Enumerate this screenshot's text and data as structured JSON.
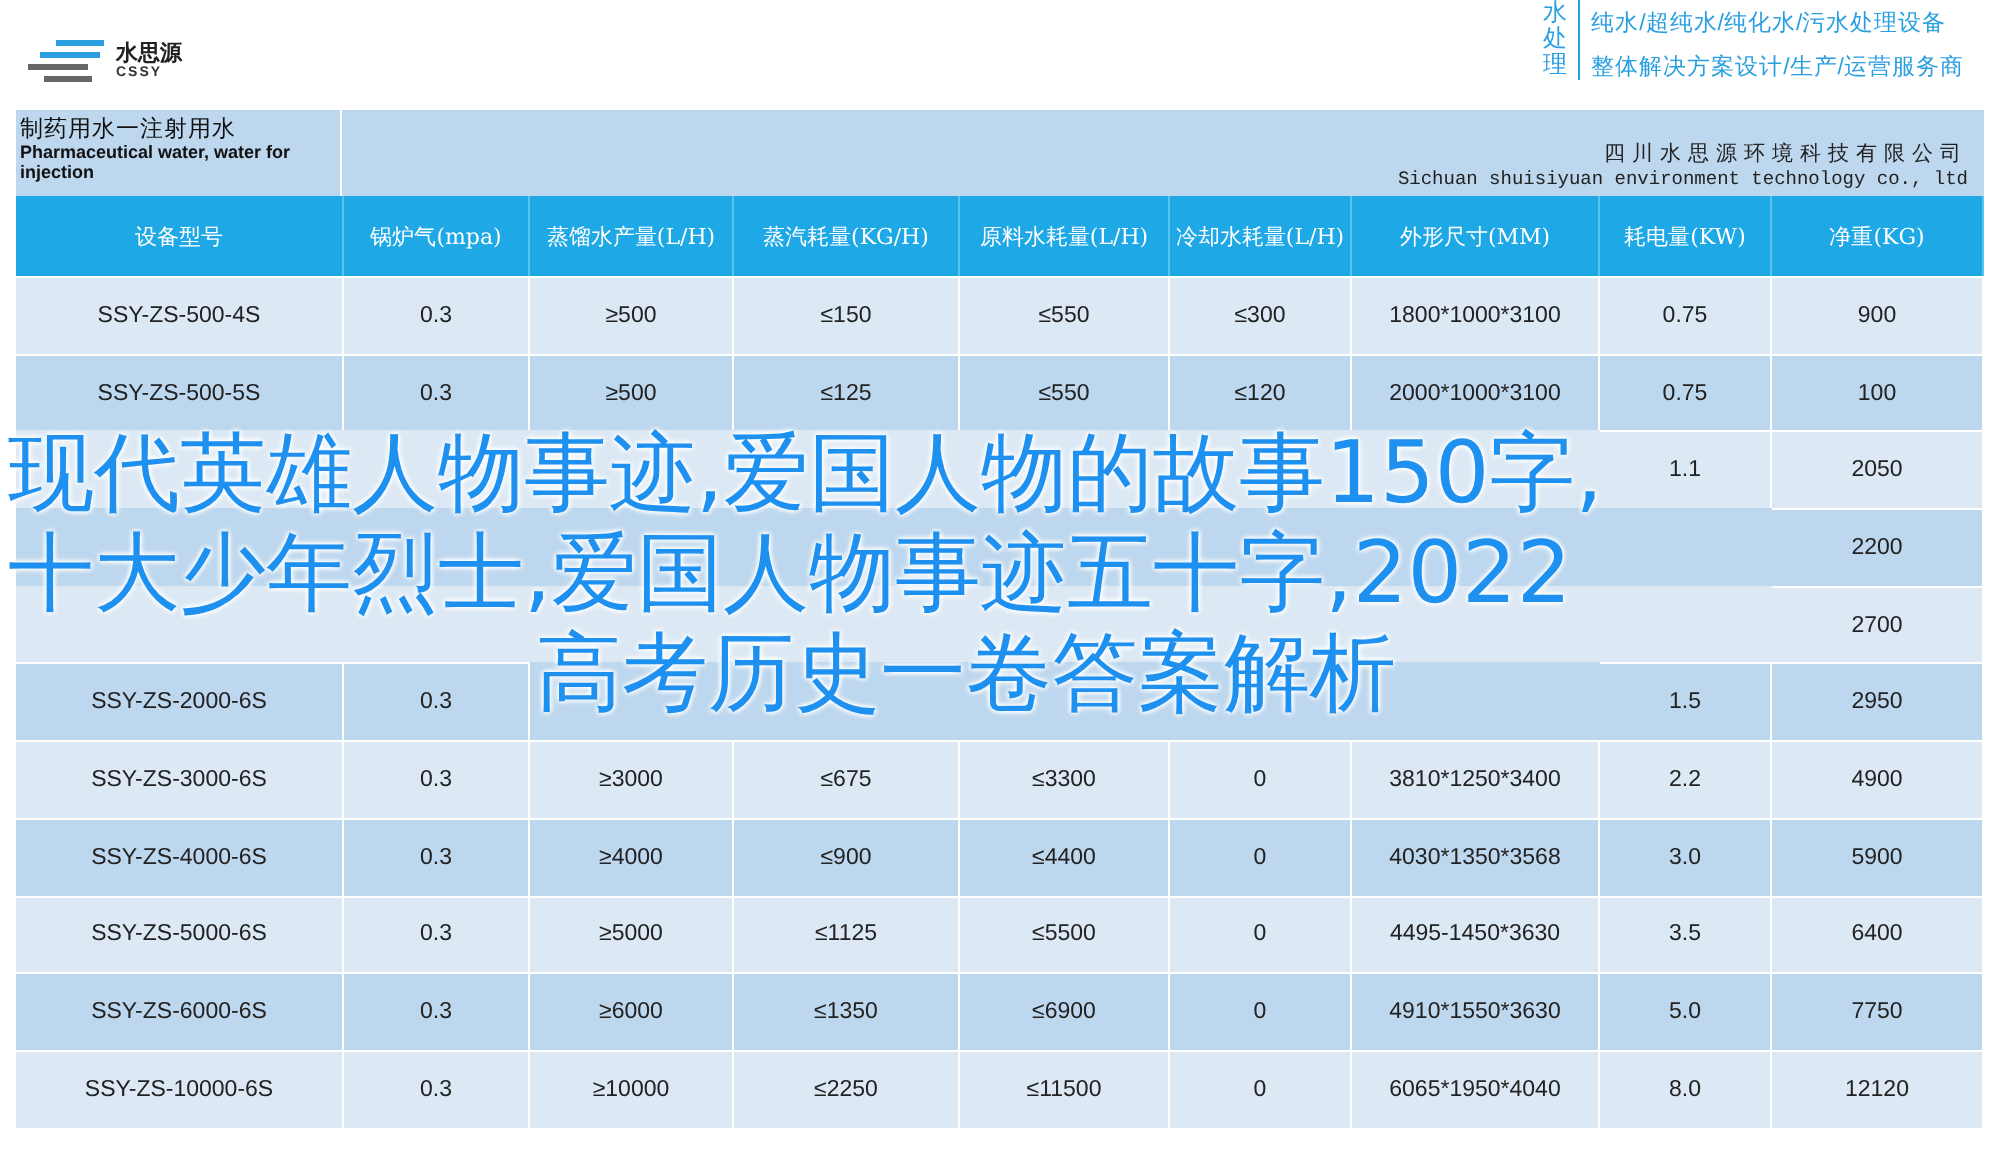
{
  "brand": {
    "name": "水思源",
    "abbr": "CSSY",
    "tagline_mark": "水处理",
    "tagline_lines": [
      "纯水/超纯水/纯化水/污水处理设备",
      "整体解决方案设计/生产/运营服务商"
    ]
  },
  "title_cell": {
    "title_cn": "制药用水一注射用水",
    "title_en": "Pharmaceutical water, water for injection"
  },
  "company": {
    "name_cn": "四川水思源环境科技有限公司",
    "name_en": "Sichuan shuisiyuan environment technology co., ltd"
  },
  "table": {
    "columns": [
      "设备型号",
      "锅炉气(mpa)",
      "蒸馏水产量(L/H)",
      "蒸汽耗量(KG/H)",
      "原料水耗量(L/H)",
      "冷却水耗量(L/H)",
      "外形尺寸(MM)",
      "耗电量(KW)",
      "净重(KG)"
    ],
    "rows": [
      [
        "SSY-ZS-500-4S",
        "0.3",
        "≥500",
        "≤150",
        "≤550",
        "≤300",
        "1800*1000*3100",
        "0.75",
        "900"
      ],
      [
        "SSY-ZS-500-5S",
        "0.3",
        "≥500",
        "≤125",
        "≤550",
        "≤120",
        "2000*1000*3100",
        "0.75",
        "100"
      ],
      [
        null,
        null,
        null,
        null,
        null,
        null,
        null,
        "1.1",
        "2050"
      ],
      [
        null,
        null,
        null,
        null,
        null,
        null,
        null,
        null,
        "2200"
      ],
      [
        null,
        null,
        null,
        null,
        null,
        null,
        null,
        null,
        "2700"
      ],
      [
        "SSY-ZS-2000-6S",
        "0.3",
        null,
        null,
        null,
        null,
        null,
        "1.5",
        "2950"
      ],
      [
        "SSY-ZS-3000-6S",
        "0.3",
        "≥3000",
        "≤675",
        "≤3300",
        "0",
        "3810*1250*3400",
        "2.2",
        "4900"
      ],
      [
        "SSY-ZS-4000-6S",
        "0.3",
        "≥4000",
        "≤900",
        "≤4400",
        "0",
        "4030*1350*3568",
        "3.0",
        "5900"
      ],
      [
        "SSY-ZS-5000-6S",
        "0.3",
        "≥5000",
        "≤1125",
        "≤5500",
        "0",
        "4495-1450*3630",
        "3.5",
        "6400"
      ],
      [
        "SSY-ZS-6000-6S",
        "0.3",
        "≥6000",
        "≤1350",
        "≤6900",
        "0",
        "4910*1550*3630",
        "5.0",
        "7750"
      ],
      [
        "SSY-ZS-10000-6S",
        "0.3",
        "≥10000",
        "≤2250",
        "≤11500",
        "0",
        "6065*1950*4040",
        "8.0",
        "12120"
      ]
    ]
  },
  "headline": [
    "现代英雄人物事迹,爱国人物的故事150字,",
    "十大少年烈士,爱国人物事迹五十字,2022",
    "高考历史一卷答案解析"
  ]
}
